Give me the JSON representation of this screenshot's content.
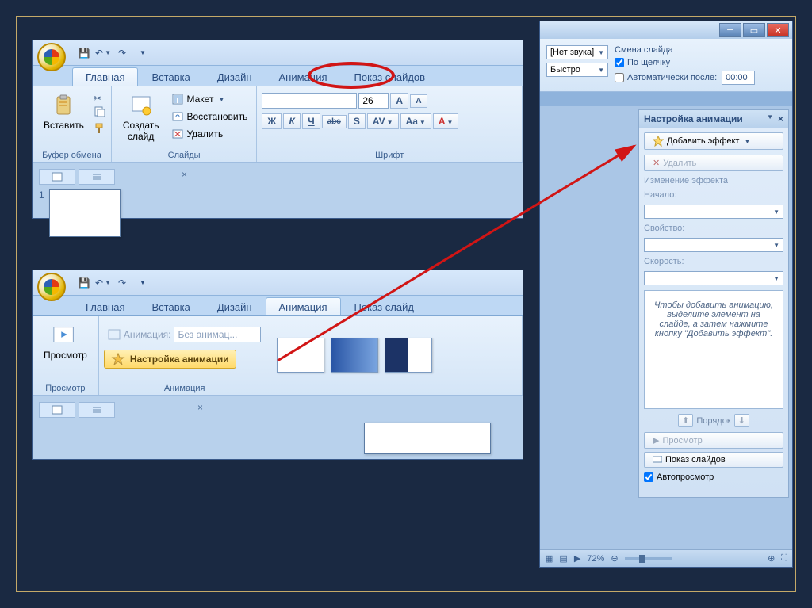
{
  "panel1": {
    "tabs": [
      "Главная",
      "Вставка",
      "Дизайн",
      "Анимация",
      "Показ слайдов"
    ],
    "active_tab_index": 0,
    "clipboard": {
      "paste": "Вставить",
      "group": "Буфер обмена"
    },
    "slides": {
      "new": "Создать\nслайд",
      "layout": "Макет",
      "reset": "Восстановить",
      "delete": "Удалить",
      "group": "Слайды"
    },
    "font": {
      "size": "26",
      "buttons": [
        "Ж",
        "К",
        "Ч",
        "abc",
        "S",
        "AV",
        "Aa",
        "A"
      ],
      "group": "Шрифт"
    },
    "slide_number": "1"
  },
  "panel2": {
    "tabs": [
      "Главная",
      "Вставка",
      "Дизайн",
      "Анимация",
      "Показ слайд"
    ],
    "active_tab_index": 3,
    "preview": {
      "label": "Просмотр",
      "group": "Просмотр"
    },
    "animation": {
      "label": "Анимация:",
      "value": "Без анимац...",
      "custom": "Настройка анимации",
      "group": "Анимация"
    }
  },
  "panel3": {
    "transition": {
      "sound": "[Нет звука]",
      "speed": "Быстро",
      "heading": "Смена слайда",
      "on_click": "По щелчку",
      "auto_after": "Автоматически после:",
      "auto_time": "00:00"
    },
    "taskpane": {
      "title": "Настройка анимации",
      "add_effect": "Добавить эффект",
      "remove": "Удалить",
      "modify": "Изменение эффекта",
      "start": "Начало:",
      "property": "Свойство:",
      "speed": "Скорость:",
      "hint": "Чтобы добавить анимацию, выделите элемент на слайде, а затем нажмите кнопку \"Добавить эффект\".",
      "reorder": "Порядок",
      "play": "Просмотр",
      "slideshow": "Показ слайдов",
      "autoplay": "Автопросмотр"
    },
    "status": {
      "zoom": "72%"
    }
  }
}
